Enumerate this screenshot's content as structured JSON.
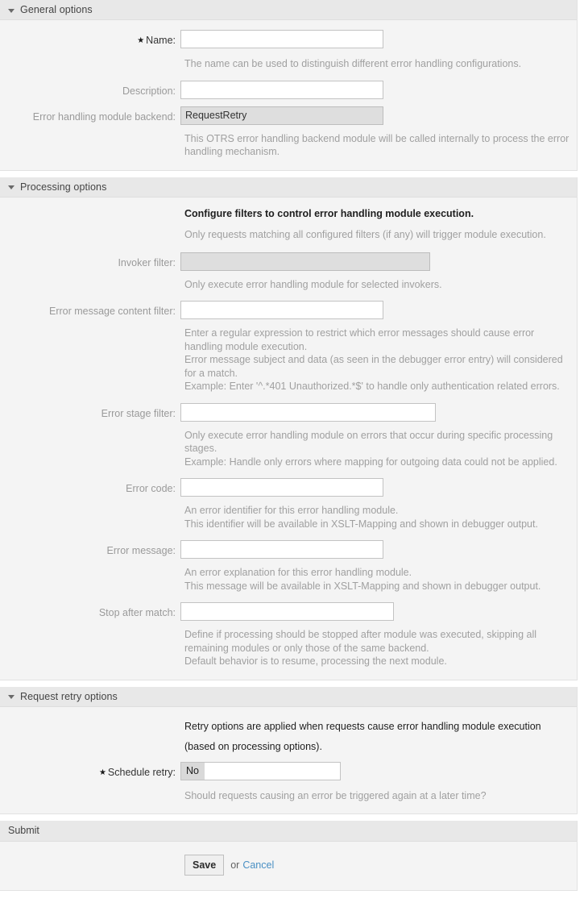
{
  "sections": [
    {
      "id": "general",
      "title": "General options",
      "collapse_icon": "triangle-down-icon"
    },
    {
      "id": "processing",
      "title": "Processing options",
      "collapse_icon": "triangle-down-icon"
    },
    {
      "id": "retry",
      "title": "Request retry options",
      "collapse_icon": "triangle-down-icon"
    }
  ],
  "general": {
    "name": {
      "label": "Name:",
      "required_marker": "★",
      "value": "",
      "help": "The name can be used to distinguish different error handling configurations."
    },
    "description": {
      "label": "Description:",
      "value": ""
    },
    "backend": {
      "label": "Error handling module backend:",
      "value": "RequestRetry",
      "help": "This OTRS error handling backend module will be called internally to process the error handling mechanism."
    }
  },
  "processing": {
    "intro_strong": "Configure filters to control error handling module execution.",
    "intro_sub": "Only requests matching all configured filters (if any) will trigger module execution.",
    "invoker_filter": {
      "label": "Invoker filter:",
      "value": "",
      "help": "Only execute error handling module for selected invokers."
    },
    "error_message_content_filter": {
      "label": "Error message content filter:",
      "value": "",
      "help_line1": "Enter a regular expression to restrict which error messages should cause error handling module execution.",
      "help_line2": "Error message subject and data (as seen in the debugger error entry) will considered for a match.",
      "help_line3": "Example: Enter '^.*401 Unauthorized.*$' to handle only authentication related errors."
    },
    "error_stage_filter": {
      "label": "Error stage filter:",
      "value": "",
      "help_line1": "Only execute error handling module on errors that occur during specific processing stages.",
      "help_line2": "Example: Handle only errors where mapping for outgoing data could not be applied."
    },
    "error_code": {
      "label": "Error code:",
      "value": "",
      "help_line1": "An error identifier for this error handling module.",
      "help_line2": "This identifier will be available in XSLT-Mapping and shown in debugger output."
    },
    "error_message": {
      "label": "Error message:",
      "value": "",
      "help_line1": "An error explanation for this error handling module.",
      "help_line2": "This message will be available in XSLT-Mapping and shown in debugger output."
    },
    "stop_after_match": {
      "label": "Stop after match:",
      "value": "",
      "help_line1": "Define if processing should be stopped after module was executed, skipping all remaining modules or only those of the same backend.",
      "help_line2": "Default behavior is to resume, processing the next module."
    }
  },
  "retry": {
    "intro": "Retry options are applied when requests cause error handling module execution (based on processing options).",
    "schedule_retry": {
      "label": "Schedule retry:",
      "required_marker": "★",
      "selected_option": "No",
      "help": "Should requests causing an error be triggered again at a later time?"
    }
  },
  "submit": {
    "title": "Submit",
    "save_label": "Save",
    "or_label": "or",
    "cancel_label": "Cancel"
  },
  "colors": {
    "section_header_bg": "#e8e8e8",
    "body_bg": "#f4f4f4",
    "label_muted": "#9a9a9a",
    "help_text": "#a0a0a0",
    "link": "#4a90c4",
    "disabled_field_bg": "#dedede"
  }
}
